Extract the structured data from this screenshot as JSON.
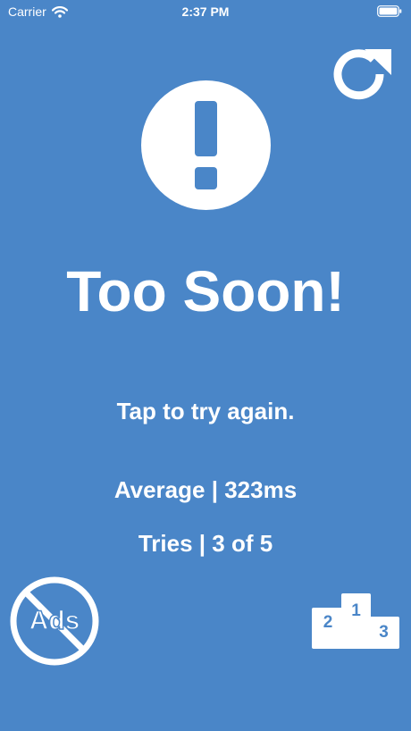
{
  "status_bar": {
    "carrier": "Carrier",
    "time": "2:37 PM",
    "wifi_icon": "wifi-icon",
    "battery_icon": "battery-full-icon"
  },
  "toolbar": {
    "refresh_icon": "refresh-icon"
  },
  "alert": {
    "icon": "exclamation-icon"
  },
  "main": {
    "headline": "Too Soon!",
    "instruction": "Tap to try again.",
    "average": "Average | 323ms",
    "tries": "Tries | 3 of 5"
  },
  "footer": {
    "no_ads_label": "Ads",
    "no_ads_icon": "no-ads-icon",
    "leaderboard_icon": "podium-icon",
    "podium": {
      "first": "1",
      "second": "2",
      "third": "3"
    }
  },
  "colors": {
    "background": "#4a86c8",
    "foreground": "#ffffff"
  }
}
